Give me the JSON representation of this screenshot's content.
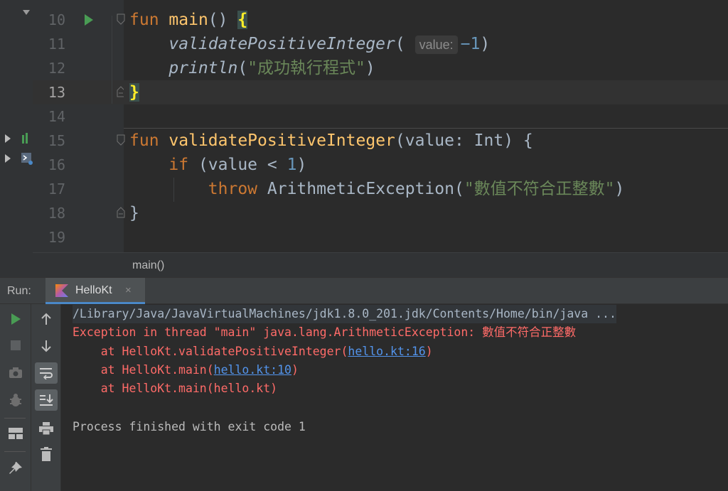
{
  "editor": {
    "lines": [
      {
        "num": "10"
      },
      {
        "num": "11"
      },
      {
        "num": "12"
      },
      {
        "num": "13"
      },
      {
        "num": "14"
      },
      {
        "num": "15"
      },
      {
        "num": "16"
      },
      {
        "num": "17"
      },
      {
        "num": "18"
      },
      {
        "num": "19"
      }
    ],
    "tokens": {
      "fun": "fun",
      "main_name": "main",
      "main_params": "() ",
      "open_brace": "{",
      "validate_call": "validatePositiveInteger",
      "paren_open": "(",
      "hint_value": "value:",
      "minus_one_minus": "−",
      "one": "1",
      "paren_close": ")",
      "println_call": "println",
      "println_arg": "\"成功執行程式\"",
      "close_brace": "}",
      "validate_decl": "validatePositiveInteger",
      "validate_params": "(value: Int) {",
      "if_kw": "if",
      "if_cond_a": " (value < ",
      "if_cond_b": ")",
      "throw_kw": "throw",
      "exception_call": " ArithmeticException(",
      "exception_msg": "\"數值不符合正整數\"",
      "exception_close": ")",
      "brace_18": "}"
    },
    "current_line": "13"
  },
  "breadcrumb": "main()",
  "run_panel": {
    "label": "Run:",
    "tab_label": "HelloKt",
    "tab_close": "×"
  },
  "console": {
    "cmd": "/Library/Java/JavaVirtualMachines/jdk1.8.0_201.jdk/Contents/Home/bin/java ...",
    "exception": "Exception in thread \"main\" java.lang.ArithmeticException: 數值不符合正整數",
    "trace": [
      {
        "prefix": "    at HelloKt.validatePositiveInteger(",
        "link": "hello.kt:16",
        "suffix": ")"
      },
      {
        "prefix": "    at HelloKt.main(",
        "link": "hello.kt:10",
        "suffix": ")"
      },
      {
        "prefix": "    at HelloKt.main(hello.kt)",
        "link": "",
        "suffix": ""
      }
    ],
    "exit": "Process finished with exit code 1"
  },
  "colors": {
    "keyword": "#cc7832",
    "function": "#ffc66d",
    "number": "#6897bb",
    "string": "#6a8759",
    "error": "#ff6b68",
    "link": "#5394ec",
    "run_green": "#499c54",
    "tab_accent": "#4a88c7"
  },
  "icons": {
    "run_gutter": "run-gutter-icon",
    "toolbar_left": [
      "run-icon",
      "stop-icon",
      "camera-icon",
      "bug-icon",
      "layout-icon",
      "pin-icon"
    ],
    "toolbar_right": [
      "arrow-up-icon",
      "arrow-down-icon",
      "soft-wrap-icon",
      "scroll-to-end-icon",
      "print-icon",
      "trash-icon"
    ]
  }
}
